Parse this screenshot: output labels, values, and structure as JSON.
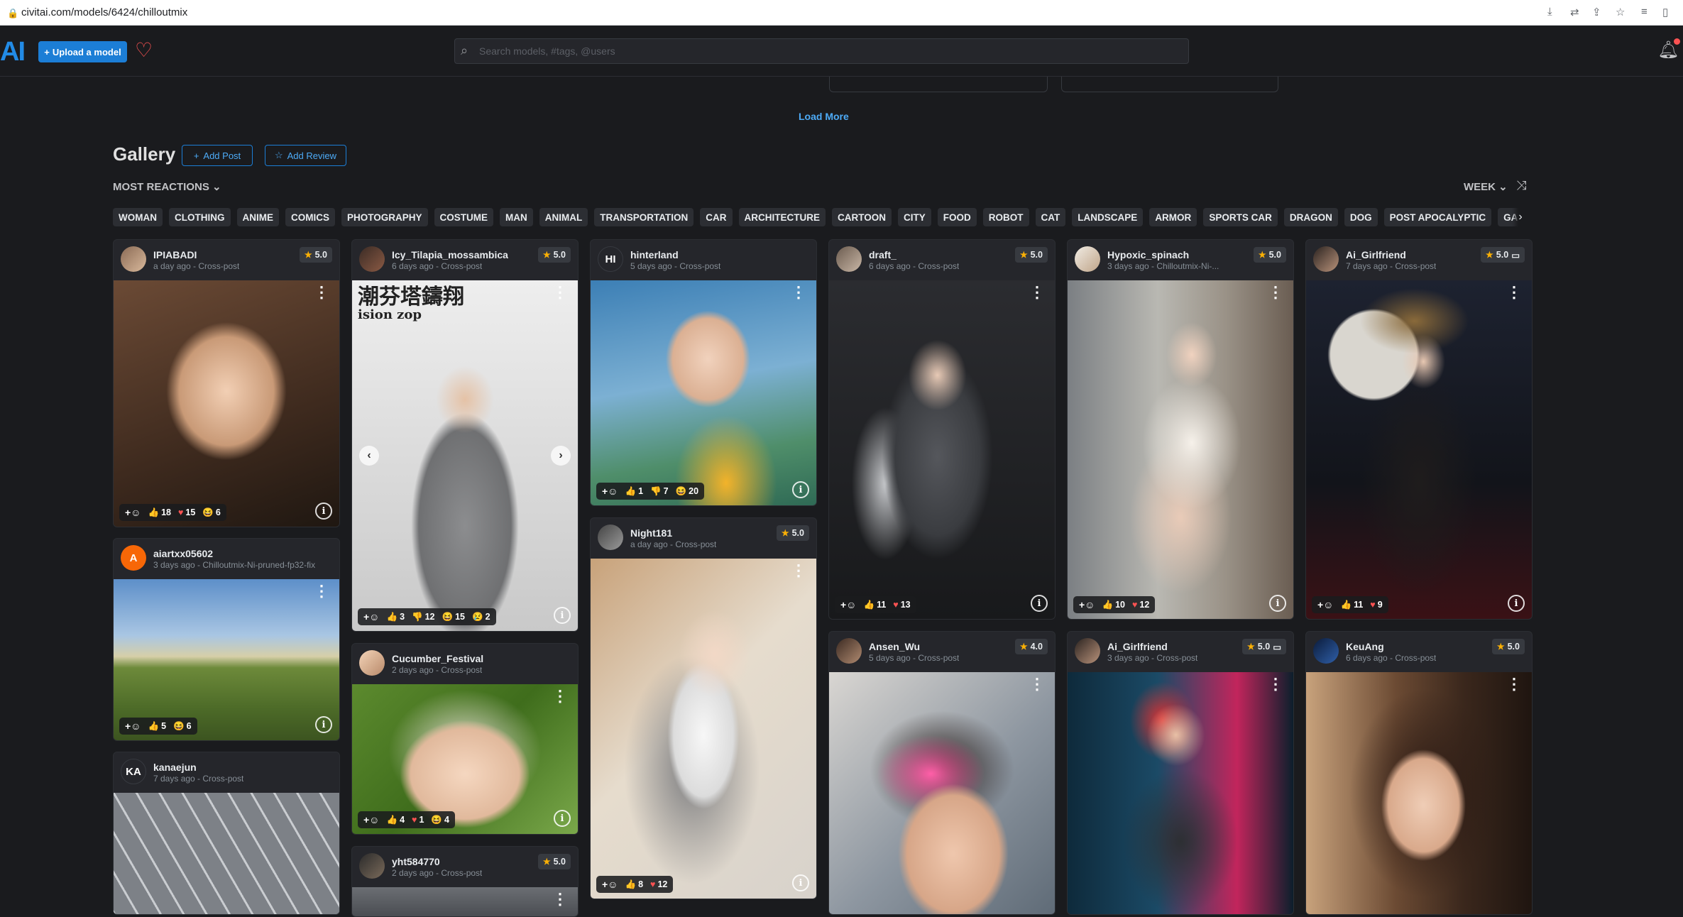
{
  "browser": {
    "url": "civitai.com/models/6424/chilloutmix"
  },
  "nav": {
    "logo": "AI",
    "upload_label": "Upload a model",
    "search_placeholder": "Search models, #tags, @users"
  },
  "load_more": "Load More",
  "gallery": {
    "title": "Gallery",
    "add_post": "Add Post",
    "add_review": "Add Review",
    "sort": "MOST REACTIONS",
    "period": "WEEK",
    "tags": [
      "WOMAN",
      "CLOTHING",
      "ANIME",
      "COMICS",
      "PHOTOGRAPHY",
      "COSTUME",
      "MAN",
      "ANIMAL",
      "TRANSPORTATION",
      "CAR",
      "ARCHITECTURE",
      "CARTOON",
      "CITY",
      "FOOD",
      "ROBOT",
      "CAT",
      "LANDSCAPE",
      "ARMOR",
      "SPORTS CAR",
      "DRAGON",
      "DOG",
      "POST APOCALYPTIC",
      "GAME CHARACTER"
    ]
  },
  "cards": [
    {
      "user": "IPIABADI",
      "meta": "a day ago - Cross-post",
      "rating": "5.0",
      "reactions": {
        "like": "18",
        "heart": "15",
        "laugh": "6"
      }
    },
    {
      "user": "aiartxx05602",
      "initial": "A",
      "meta": "3 days ago - Chilloutmix-Ni-pruned-fp32-fix",
      "reactions": {
        "like": "5",
        "laugh": "6"
      }
    },
    {
      "user": "kanaejun",
      "initial": "KA",
      "meta": "7 days ago - Cross-post"
    },
    {
      "user": "Icy_Tilapia_mossambica",
      "meta": "6 days ago - Cross-post",
      "rating": "5.0",
      "overtext": "潮芬塔鑄翔",
      "overtext_small": "ision zop",
      "reactions": {
        "like": "3",
        "dislike": "12",
        "laugh": "15",
        "cry": "2"
      }
    },
    {
      "user": "Cucumber_Festival",
      "meta": "2 days ago - Cross-post",
      "reactions": {
        "like": "4",
        "heart": "1",
        "laugh": "4"
      }
    },
    {
      "user": "yht584770",
      "meta": "2 days ago - Cross-post",
      "rating": "5.0"
    },
    {
      "user": "hinterland",
      "initial": "HI",
      "meta": "5 days ago - Cross-post",
      "reactions": {
        "like": "1",
        "dislike": "7",
        "laugh": "20"
      }
    },
    {
      "user": "Night181",
      "meta": "a day ago - Cross-post",
      "rating": "5.0",
      "reactions": {
        "like": "8",
        "heart": "12"
      }
    },
    {
      "user": "draft_",
      "meta": "6 days ago - Cross-post",
      "rating": "5.0",
      "reactions": {
        "like": "11",
        "heart": "13"
      }
    },
    {
      "user": "Ansen_Wu",
      "meta": "5 days ago - Cross-post",
      "rating": "4.0"
    },
    {
      "user": "Hypoxic_spinach",
      "meta": "3 days ago - Chilloutmix-Ni-...",
      "rating": "5.0",
      "reactions": {
        "like": "10",
        "heart": "12"
      }
    },
    {
      "user": "Ai_Girlfriend",
      "meta": "3 days ago - Cross-post",
      "rating": "5.0"
    },
    {
      "user": "Ai_Girlfriend",
      "meta": "7 days ago - Cross-post",
      "rating": "5.0",
      "reactions": {
        "like": "11",
        "heart": "9"
      }
    },
    {
      "user": "KeuAng",
      "meta": "6 days ago - Cross-post",
      "rating": "5.0"
    }
  ]
}
